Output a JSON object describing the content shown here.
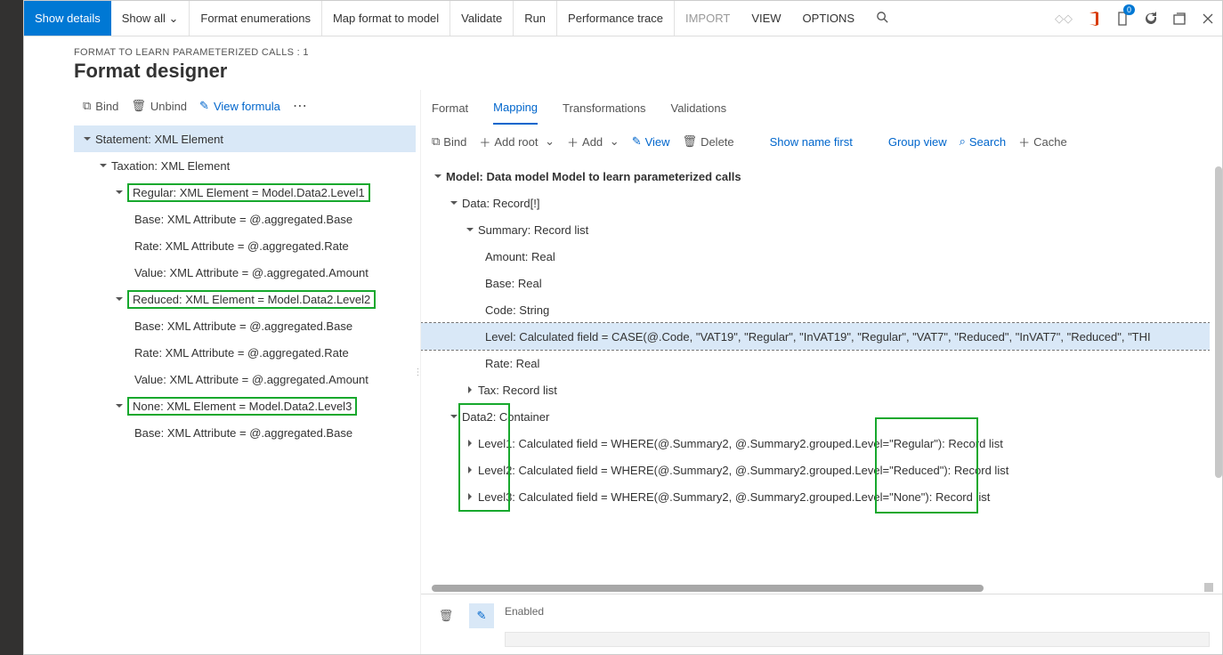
{
  "cmdbar": {
    "show_details": "Show details",
    "show_all": "Show all",
    "format_enum": "Format enumerations",
    "map_format": "Map format to model",
    "validate": "Validate",
    "run": "Run",
    "perf_trace": "Performance trace",
    "import": "IMPORT",
    "view": "VIEW",
    "options": "OPTIONS",
    "badge_count": "0"
  },
  "header": {
    "crumb": "FORMAT TO LEARN PARAMETERIZED CALLS : 1",
    "title": "Format designer"
  },
  "left_tools": {
    "bind": "Bind",
    "unbind": "Unbind",
    "view_formula": "View formula"
  },
  "tabs": {
    "format": "Format",
    "mapping": "Mapping",
    "transformations": "Transformations",
    "validations": "Validations"
  },
  "rtbar": {
    "bind": "Bind",
    "add_root": "Add root",
    "add": "Add",
    "view": "View",
    "delete": "Delete",
    "show_name_first": "Show name first",
    "group_view": "Group view",
    "search": "Search",
    "cache": "Cache"
  },
  "left_tree": {
    "n0": "Statement: XML Element",
    "n1": "Taxation: XML Element",
    "n2": "Regular: XML Element = Model.Data2.Level1",
    "n2a": "Base: XML Attribute = @.aggregated.Base",
    "n2b": "Rate: XML Attribute = @.aggregated.Rate",
    "n2c": "Value: XML Attribute = @.aggregated.Amount",
    "n3": "Reduced: XML Element = Model.Data2.Level2",
    "n3a": "Base: XML Attribute = @.aggregated.Base",
    "n3b": "Rate: XML Attribute = @.aggregated.Rate",
    "n3c": "Value: XML Attribute = @.aggregated.Amount",
    "n4": "None: XML Element = Model.Data2.Level3",
    "n4a": "Base: XML Attribute = @.aggregated.Base"
  },
  "right_tree": {
    "r0": "Model: Data model Model to learn parameterized calls",
    "r1": "Data: Record[!]",
    "r2": "Summary: Record list",
    "r2a": "Amount: Real",
    "r2b": "Base: Real",
    "r2c": "Code: String",
    "r2d": "Level: Calculated field = CASE(@.Code, \"VAT19\", \"Regular\", \"InVAT19\", \"Regular\", \"VAT7\", \"Reduced\", \"InVAT7\", \"Reduced\", \"THI",
    "r2e": "Rate: Real",
    "r3": "Tax: Record list",
    "r4": "Data2: Container",
    "r4a": "Level1: Calculated field = WHERE(@.Summary2, @.Summary2.grouped.Level=\"Regular\"): Record list",
    "r4b": "Level2: Calculated field = WHERE(@.Summary2, @.Summary2.grouped.Level=\"Reduced\"): Record list",
    "r4c": "Level3: Calculated field = WHERE(@.Summary2, @.Summary2.grouped.Level=\"None\"): Record list"
  },
  "footer": {
    "enabled": "Enabled"
  }
}
